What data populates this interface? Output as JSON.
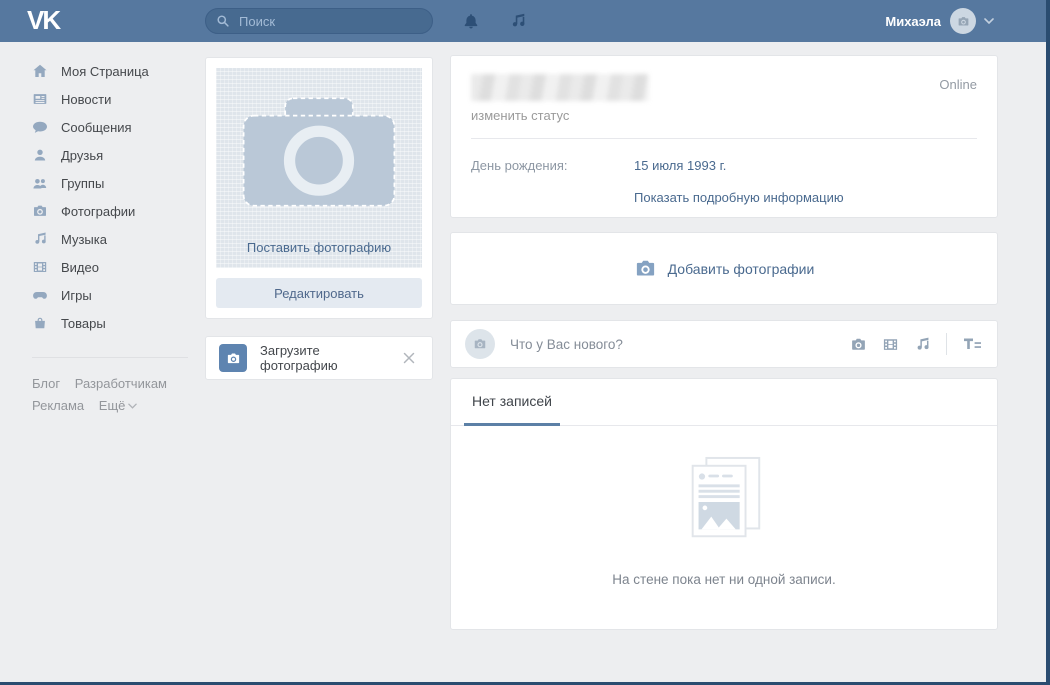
{
  "header": {
    "logo": "VK",
    "search": {
      "placeholder": "Поиск"
    },
    "user": {
      "name": "Михаэла"
    }
  },
  "sidebar": {
    "items": [
      {
        "label": "Моя Страница"
      },
      {
        "label": "Новости"
      },
      {
        "label": "Сообщения"
      },
      {
        "label": "Друзья"
      },
      {
        "label": "Группы"
      },
      {
        "label": "Фотографии"
      },
      {
        "label": "Музыка"
      },
      {
        "label": "Видео"
      },
      {
        "label": "Игры"
      },
      {
        "label": "Товары"
      }
    ],
    "footer_links": [
      {
        "label": "Блог"
      },
      {
        "label": "Разработчикам"
      },
      {
        "label": "Реклама"
      },
      {
        "label": "Ещё"
      }
    ]
  },
  "profile_column": {
    "set_photo_label": "Поставить фотографию",
    "edit_button_label": "Редактировать",
    "upload_photo_label": "Загрузите фотографию"
  },
  "profile": {
    "online_status": "Online",
    "change_status_link": "изменить статус",
    "birthday_label": "День рождения:",
    "birthday_value": "15 июля 1993 г.",
    "show_details_link": "Показать подробную информацию"
  },
  "add_photos": {
    "label": "Добавить фотографии"
  },
  "composer": {
    "placeholder": "Что у Вас нового?"
  },
  "wall": {
    "tab_label": "Нет записей",
    "empty_message": "На стене пока нет ни одной записи."
  },
  "colors": {
    "header_bg": "#56789f",
    "search_bg": "#476a90",
    "header_icon": "#2d4f76",
    "accent_link": "#4a6a8f",
    "sidebar_icon": "#94a8bf",
    "page_bg": "#edeef0",
    "window_edge": "#2a4c70",
    "tab_underline": "#5c80a6",
    "upload_icon_bg": "#5e84b0"
  },
  "icons": {
    "search-icon": "magnifier",
    "bell-icon": "bell",
    "music-icon": "beamed-notes",
    "chevron-down-icon": "chevron-down",
    "camera-icon": "camera",
    "home-icon": "house",
    "news-icon": "newspaper",
    "messages-icon": "speech-bubble",
    "friends-icon": "person",
    "groups-icon": "people",
    "photos-icon": "camera",
    "video-icon": "film-strip",
    "games-icon": "gamepad",
    "goods-icon": "shopping-bag",
    "close-icon": "x-cross",
    "text-format-icon": "T-with-lines",
    "empty-wall-icon": "stacked-pages"
  }
}
